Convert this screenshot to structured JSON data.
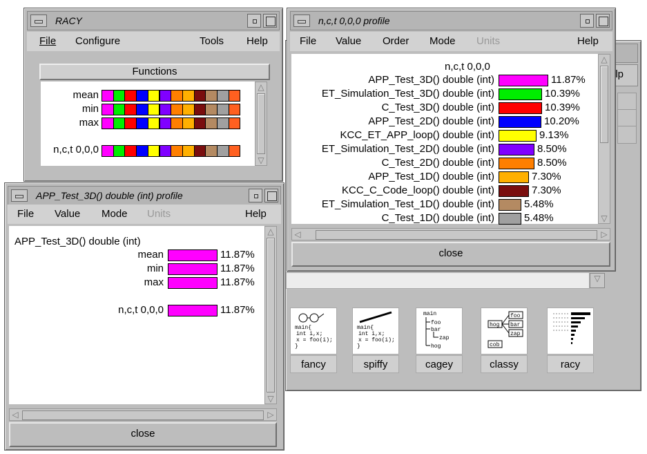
{
  "racy_window": {
    "title": "RACY",
    "menu": {
      "file": "File",
      "configure": "Configure",
      "tools": "Tools",
      "help": "Help"
    },
    "functions_button": "Functions",
    "rows": [
      {
        "label": "mean"
      },
      {
        "label": "min"
      },
      {
        "label": "max"
      },
      {
        "label": "n,c,t 0,0,0"
      }
    ],
    "bar_colors": [
      "#ff00ff",
      "#00ee00",
      "#ff0000",
      "#0000ff",
      "#ffff00",
      "#8000ff",
      "#ff7f00",
      "#ffb000",
      "#7a0e0e",
      "#b48a62",
      "#a0a0a0",
      "#ff6020"
    ]
  },
  "thread_window": {
    "title": "n,c,t 0,0,0 profile",
    "menu": {
      "file": "File",
      "value": "Value",
      "order": "Order",
      "mode": "Mode",
      "units": "Units",
      "help": "Help"
    },
    "header": "n,c,t 0,0,0",
    "rows": [
      {
        "label": "APP_Test_3D() double (int)",
        "value": "11.87%",
        "pct": 11.87,
        "color": "#ff00ff"
      },
      {
        "label": "ET_Simulation_Test_3D() double (int)",
        "value": "10.39%",
        "pct": 10.39,
        "color": "#00ee00"
      },
      {
        "label": "C_Test_3D() double (int)",
        "value": "10.39%",
        "pct": 10.39,
        "color": "#ff0000"
      },
      {
        "label": "APP_Test_2D() double (int)",
        "value": "10.20%",
        "pct": 10.2,
        "color": "#0000ff"
      },
      {
        "label": "KCC_ET_APP_loop() double (int)",
        "value": "9.13%",
        "pct": 9.13,
        "color": "#ffff00"
      },
      {
        "label": "ET_Simulation_Test_2D() double (int)",
        "value": "8.50%",
        "pct": 8.5,
        "color": "#8000ff"
      },
      {
        "label": "C_Test_2D() double (int)",
        "value": "8.50%",
        "pct": 8.5,
        "color": "#ff7f00"
      },
      {
        "label": "APP_Test_1D() double (int)",
        "value": "7.30%",
        "pct": 7.3,
        "color": "#ffb000"
      },
      {
        "label": "KCC_C_Code_loop() double (int)",
        "value": "7.30%",
        "pct": 7.3,
        "color": "#7a0e0e"
      },
      {
        "label": "ET_Simulation_Test_1D() double (int)",
        "value": "5.48%",
        "pct": 5.48,
        "color": "#b48a62"
      },
      {
        "label": "C_Test_1D() double (int)",
        "value": "5.48%",
        "pct": 5.48,
        "color": "#a0a0a0"
      }
    ],
    "close": "close"
  },
  "func_window": {
    "title": "APP_Test_3D() double (int) profile",
    "menu": {
      "file": "File",
      "value": "Value",
      "mode": "Mode",
      "units": "Units",
      "help": "Help"
    },
    "header": "APP_Test_3D() double (int)",
    "rows": [
      {
        "label": "mean",
        "value": "11.87%"
      },
      {
        "label": "min",
        "value": "11.87%"
      },
      {
        "label": "max",
        "value": "11.87%"
      },
      {
        "label": "n,c,t 0,0,0",
        "value": "11.87%"
      }
    ],
    "bar_color": "#ff00ff",
    "close": "close"
  },
  "back_window": {
    "partial_label": "elp",
    "icons": [
      {
        "name": "fancy",
        "code": "main{\n int i,x;\n x = foo(i);\n}"
      },
      {
        "name": "spiffy",
        "code": "main{\n int i,x;\n x = foo(i);\n}"
      },
      {
        "name": "cagey",
        "tree": [
          "main",
          "foo",
          "bar",
          "zap",
          "hog"
        ]
      },
      {
        "name": "classy",
        "boxes": [
          "foo",
          "bar",
          "zap",
          "hog",
          "cob"
        ]
      },
      {
        "name": "racy"
      }
    ]
  }
}
